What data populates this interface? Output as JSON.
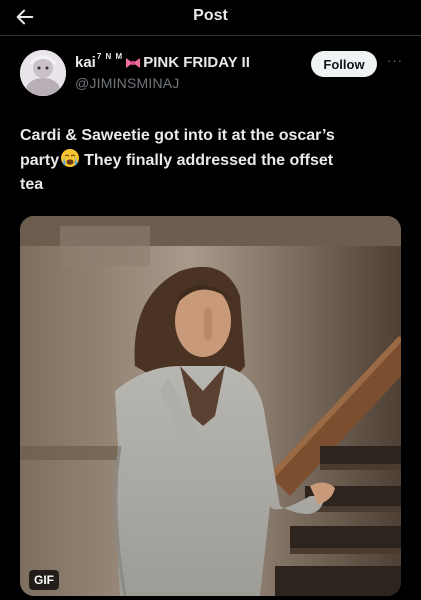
{
  "header": {
    "title": "Post",
    "back_icon": "arrow-left-icon"
  },
  "post": {
    "author": {
      "name_prefix": "kai",
      "name_sup": "7 N M",
      "name_suffix": "PINK FRIDAY II",
      "bow_icon": "pink-bow-icon",
      "handle": "@JIMINSMINAJ"
    },
    "follow_label": "Follow",
    "more_label": "···",
    "text_lines": [
      "Cardi & Saweetie got into it at the oscar’s",
      "party",
      "They finally addressed the offset",
      "tea"
    ],
    "emoji_icon": "crying-face-icon",
    "media": {
      "badge": "GIF"
    }
  },
  "colors": {
    "background": "#000000",
    "text": "#e7e9ea",
    "secondary": "#71767b",
    "follow_bg": "#eff3f4"
  }
}
